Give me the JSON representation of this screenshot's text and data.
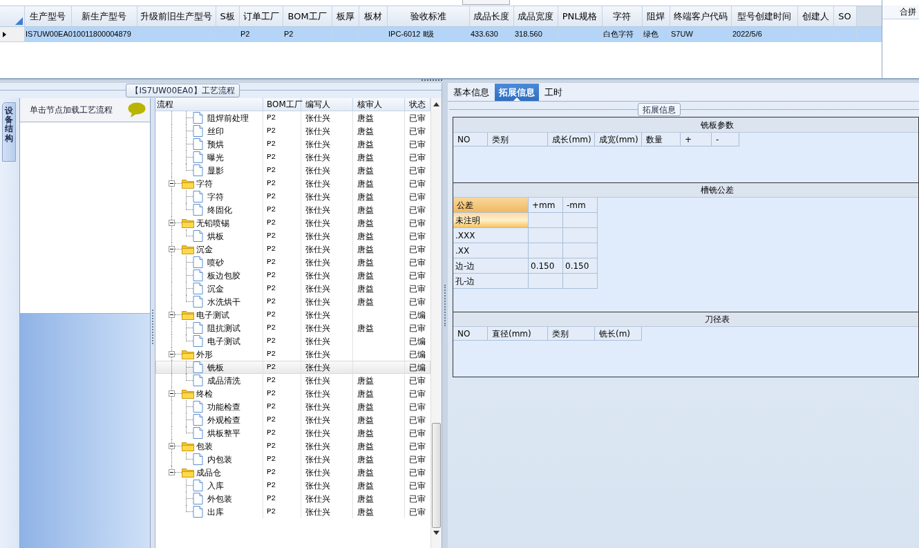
{
  "grid": {
    "columns": [
      "生产型号",
      "新生产型号",
      "升级前旧生产型号",
      "S板",
      "订单工厂",
      "BOM工厂",
      "板厚",
      "板材",
      "验收标准",
      "成品长度",
      "成品宽度",
      "PNL规格",
      "字符",
      "阻焊",
      "终端客户代码",
      "型号创建时间",
      "创建人",
      "SO"
    ],
    "rows": [
      {
        "selected": true,
        "cells": [
          "IS7UW00EA0",
          "10011800004879",
          null,
          null,
          "P2",
          "P2",
          null,
          null,
          "IPC-6012 Ⅱ级",
          "433.630",
          "318.560",
          null,
          "白色字符",
          "绿色",
          "S7UW",
          "2022/5/6",
          null,
          null
        ]
      }
    ]
  },
  "side_panel": {
    "header": "合拼"
  },
  "process": {
    "title": "【IS7UW00EA0】工艺流程",
    "side_tab": {
      "label": "设备结构",
      "selected": true
    },
    "hint": "单击节点加载工艺流程",
    "columns": [
      "流程",
      "BOM工厂",
      "编写人",
      "核审人",
      "状态"
    ],
    "nodes": [
      {
        "kind": "folder",
        "children": [
          {
            "kind": "file",
            "label": "阻焊前处理",
            "bom": "P2",
            "author": "张仕兴",
            "reviewer": "唐益",
            "status": "已审",
            "selected": false
          },
          {
            "kind": "file",
            "label": "丝印",
            "bom": "P2",
            "author": "张仕兴",
            "reviewer": "唐益",
            "status": "已审",
            "selected": false
          },
          {
            "kind": "file",
            "label": "预烘",
            "bom": "P2",
            "author": "张仕兴",
            "reviewer": "唐益",
            "status": "已审",
            "selected": false
          },
          {
            "kind": "file",
            "label": "曝光",
            "bom": "P2",
            "author": "张仕兴",
            "reviewer": "唐益",
            "status": "已审",
            "selected": false
          },
          {
            "kind": "file",
            "label": "显影",
            "bom": "P2",
            "author": "张仕兴",
            "reviewer": "唐益",
            "status": "已审",
            "selected": false
          }
        ]
      },
      {
        "kind": "folder",
        "label": "字符",
        "bom": "P2",
        "author": "张仕兴",
        "reviewer": "唐益",
        "status": "已审",
        "selected": false,
        "expanded": true,
        "children": [
          {
            "kind": "file",
            "label": "字符",
            "bom": "P2",
            "author": "张仕兴",
            "reviewer": "唐益",
            "status": "已审",
            "selected": false
          },
          {
            "kind": "file",
            "label": "终固化",
            "bom": "P2",
            "author": "张仕兴",
            "reviewer": "唐益",
            "status": "已审",
            "selected": false
          }
        ]
      },
      {
        "kind": "folder",
        "label": "无铅喷锡",
        "bom": "P2",
        "author": "张仕兴",
        "reviewer": "唐益",
        "status": "已审",
        "selected": false,
        "expanded": true,
        "children": [
          {
            "kind": "file",
            "label": "烘板",
            "bom": "P2",
            "author": "张仕兴",
            "reviewer": "唐益",
            "status": "已审",
            "selected": false
          }
        ]
      },
      {
        "kind": "folder",
        "label": "沉金",
        "bom": "P2",
        "author": "张仕兴",
        "reviewer": "唐益",
        "status": "已审",
        "selected": false,
        "expanded": true,
        "children": [
          {
            "kind": "file",
            "label": "喷砂",
            "bom": "P2",
            "author": "张仕兴",
            "reviewer": "唐益",
            "status": "已审",
            "selected": false
          },
          {
            "kind": "file",
            "label": "板边包胶",
            "bom": "P2",
            "author": "张仕兴",
            "reviewer": "唐益",
            "status": "已审",
            "selected": false
          },
          {
            "kind": "file",
            "label": "沉金",
            "bom": "P2",
            "author": "张仕兴",
            "reviewer": "唐益",
            "status": "已审",
            "selected": false
          },
          {
            "kind": "file",
            "label": "水洗烘干",
            "bom": "P2",
            "author": "张仕兴",
            "reviewer": "唐益",
            "status": "已审",
            "selected": false
          }
        ]
      },
      {
        "kind": "folder",
        "label": "电子测试",
        "bom": "P2",
        "author": "张仕兴",
        "status": "已编",
        "selected": false,
        "expanded": true,
        "children": [
          {
            "kind": "file",
            "label": "阻抗测试",
            "bom": "P2",
            "author": "张仕兴",
            "reviewer": "唐益",
            "status": "已审",
            "selected": false
          },
          {
            "kind": "file",
            "label": "电子测试",
            "bom": "P2",
            "author": "张仕兴",
            "status": "已编",
            "selected": false
          }
        ]
      },
      {
        "kind": "folder",
        "label": "外形",
        "bom": "P2",
        "author": "张仕兴",
        "status": "已编",
        "selected": false,
        "expanded": true,
        "children": [
          {
            "kind": "file",
            "label": "铣板",
            "bom": "P2",
            "author": "张仕兴",
            "status": "已编",
            "selected": true
          },
          {
            "kind": "file",
            "label": "成品清洗",
            "bom": "P2",
            "author": "张仕兴",
            "reviewer": "唐益",
            "status": "已审",
            "selected": false
          }
        ]
      },
      {
        "kind": "folder",
        "label": "终检",
        "bom": "P2",
        "author": "张仕兴",
        "reviewer": "唐益",
        "status": "已审",
        "selected": false,
        "expanded": true,
        "children": [
          {
            "kind": "file",
            "label": "功能检查",
            "bom": "P2",
            "author": "张仕兴",
            "reviewer": "唐益",
            "status": "已审",
            "selected": false
          },
          {
            "kind": "file",
            "label": "外观检查",
            "bom": "P2",
            "author": "张仕兴",
            "reviewer": "唐益",
            "status": "已审",
            "selected": false
          },
          {
            "kind": "file",
            "label": "烘板整平",
            "bom": "P2",
            "author": "张仕兴",
            "reviewer": "唐益",
            "status": "已审",
            "selected": false
          }
        ]
      },
      {
        "kind": "folder",
        "label": "包装",
        "bom": "P2",
        "author": "张仕兴",
        "reviewer": "唐益",
        "status": "已审",
        "selected": false,
        "expanded": true,
        "children": [
          {
            "kind": "file",
            "label": "内包装",
            "bom": "P2",
            "author": "张仕兴",
            "reviewer": "唐益",
            "status": "已审",
            "selected": false
          }
        ]
      },
      {
        "kind": "folder",
        "label": "成品仓",
        "bom": "P2",
        "author": "张仕兴",
        "reviewer": "唐益",
        "status": "已审",
        "selected": false,
        "expanded": true,
        "children": [
          {
            "kind": "file",
            "label": "入库",
            "bom": "P2",
            "author": "张仕兴",
            "reviewer": "唐益",
            "status": "已审",
            "selected": false
          },
          {
            "kind": "file",
            "label": "外包装",
            "bom": "P2",
            "author": "张仕兴",
            "reviewer": "唐益",
            "status": "已审",
            "selected": false
          },
          {
            "kind": "file",
            "label": "出库",
            "bom": "P2",
            "author": "张仕兴",
            "reviewer": "唐益",
            "status": "已审",
            "selected": false
          }
        ]
      }
    ]
  },
  "detail": {
    "tabs": [
      {
        "label": "基本信息",
        "selected": false
      },
      {
        "label": "拓展信息",
        "selected": true
      },
      {
        "label": "工时",
        "selected": false
      }
    ],
    "group_title": "拓展信息",
    "milling": {
      "title": "铣板参数",
      "columns": [
        "NO",
        "类别",
        "成长(mm)",
        "成宽(mm)",
        "数量",
        "+",
        "-"
      ]
    },
    "tolerance": {
      "title": "槽铣公差",
      "columns": [
        "公差",
        "+mm",
        "-mm"
      ],
      "rows": [
        {
          "selected": true,
          "cells": [
            "未注明",
            null,
            null
          ]
        },
        {
          "selected": false,
          "cells": [
            ".XXX",
            null,
            null
          ]
        },
        {
          "selected": false,
          "cells": [
            ".XX",
            null,
            null
          ]
        },
        {
          "selected": false,
          "cells": [
            "边-边",
            "0.150",
            "0.150"
          ]
        },
        {
          "selected": false,
          "cells": [
            "孔-边",
            null,
            null
          ]
        }
      ]
    },
    "tools": {
      "title": "刀径表",
      "columns": [
        "NO",
        "直径(mm)",
        "类别",
        "铣长(m)"
      ]
    }
  }
}
